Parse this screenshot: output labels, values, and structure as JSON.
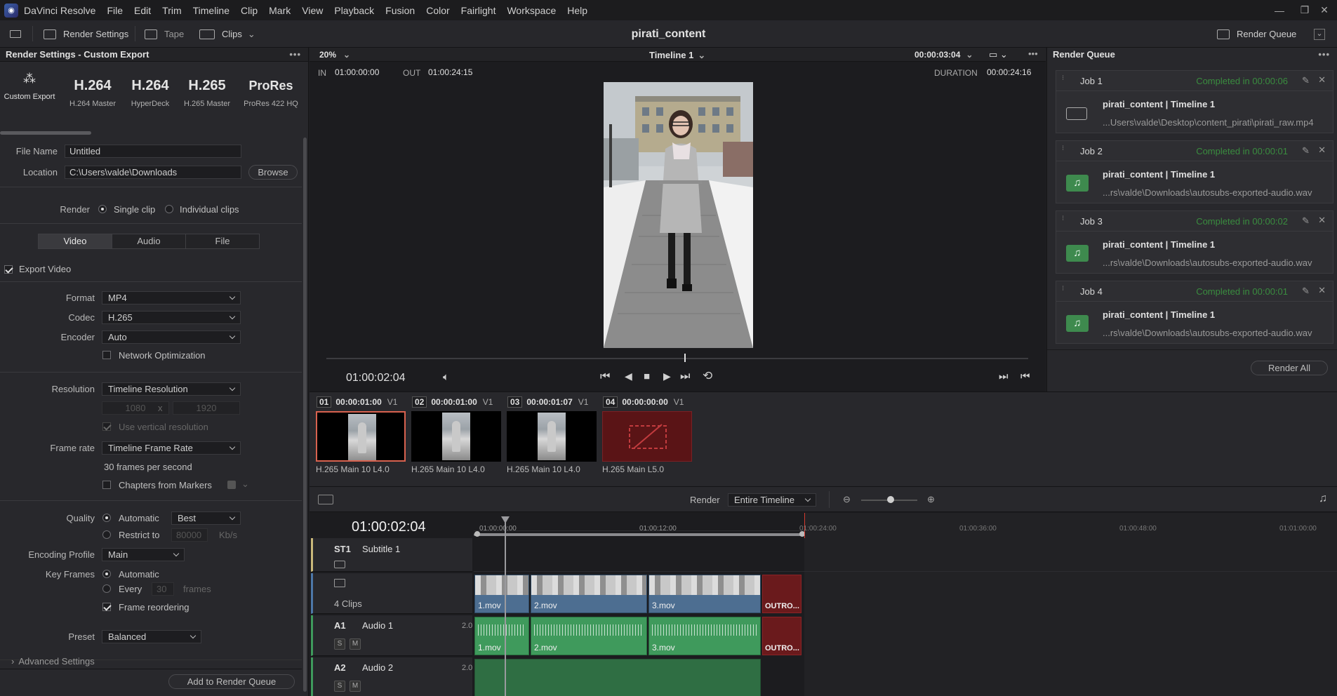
{
  "app": {
    "name": "DaVinci Resolve",
    "menu": [
      "File",
      "Edit",
      "Trim",
      "Timeline",
      "Clip",
      "Mark",
      "View",
      "Playback",
      "Fusion",
      "Color",
      "Fairlight",
      "Workspace",
      "Help"
    ]
  },
  "toolbar": {
    "render_settings": "Render Settings",
    "tape": "Tape",
    "clips": "Clips",
    "project_title": "pirati_content",
    "render_queue": "Render Queue"
  },
  "render_settings": {
    "title": "Render Settings - Custom Export",
    "presets": [
      {
        "big": "",
        "label": "Custom Export"
      },
      {
        "big": "H.264",
        "label": "H.264 Master"
      },
      {
        "big": "H.264",
        "label": "HyperDeck"
      },
      {
        "big": "H.265",
        "label": "H.265 Master"
      },
      {
        "big": "ProRes",
        "label": "ProRes 422 HQ"
      }
    ],
    "file_name_label": "File Name",
    "file_name_value": "Untitled",
    "location_label": "Location",
    "location_value": "C:\\Users\\valde\\Downloads",
    "browse": "Browse",
    "render_label": "Render",
    "single_clip": "Single clip",
    "individual_clips": "Individual clips",
    "tabs": [
      "Video",
      "Audio",
      "File"
    ],
    "export_video": "Export Video",
    "format_label": "Format",
    "format_value": "MP4",
    "codec_label": "Codec",
    "codec_value": "H.265",
    "encoder_label": "Encoder",
    "encoder_value": "Auto",
    "network_optimization": "Network Optimization",
    "resolution_label": "Resolution",
    "resolution_value": "Timeline Resolution",
    "res_w": "1080",
    "res_x": "x",
    "res_h": "1920",
    "use_vertical": "Use vertical resolution",
    "frame_rate_label": "Frame rate",
    "frame_rate_value": "Timeline Frame Rate",
    "fps_text": "30 frames per second",
    "chapters": "Chapters from Markers",
    "quality_label": "Quality",
    "quality_auto": "Automatic",
    "quality_best": "Best",
    "restrict_to": "Restrict to",
    "restrict_value": "80000",
    "kbs": "Kb/s",
    "encoding_profile_label": "Encoding Profile",
    "encoding_profile_value": "Main",
    "key_frames_label": "Key Frames",
    "kf_auto": "Automatic",
    "kf_every": "Every",
    "kf_every_value": "30",
    "kf_frames": "frames",
    "frame_reordering": "Frame reordering",
    "preset_label": "Preset",
    "preset_value": "Balanced",
    "advanced": "Advanced Settings",
    "add_to_queue": "Add to Render Queue"
  },
  "viewer": {
    "zoom": "20%",
    "timeline_name": "Timeline 1",
    "timecode_top": "00:00:03:04",
    "in_label": "IN",
    "in_value": "01:00:00:00",
    "out_label": "OUT",
    "out_value": "01:00:24:15",
    "duration_label": "DURATION",
    "duration_value": "00:00:24:16",
    "current_tc": "01:00:02:04",
    "scrub_progress": 0.51
  },
  "render_queue": {
    "title": "Render Queue",
    "jobs": [
      {
        "title": "Job 1",
        "done": "Completed in 00:00:06",
        "name": "pirati_content | Timeline 1",
        "path": "...Users\\valde\\Desktop\\content_pirati\\pirati_raw.mp4",
        "icon": "film-icon"
      },
      {
        "title": "Job 2",
        "done": "Completed in 00:00:01",
        "name": "pirati_content | Timeline 1",
        "path": "...rs\\valde\\Downloads\\autosubs-exported-audio.wav",
        "icon": "music-icon"
      },
      {
        "title": "Job 3",
        "done": "Completed in 00:00:02",
        "name": "pirati_content | Timeline 1",
        "path": "...rs\\valde\\Downloads\\autosubs-exported-audio.wav",
        "icon": "music-icon"
      },
      {
        "title": "Job 4",
        "done": "Completed in 00:00:01",
        "name": "pirati_content | Timeline 1",
        "path": "...rs\\valde\\Downloads\\autosubs-exported-audio.wav",
        "icon": "music-icon"
      }
    ],
    "render_all": "Render All"
  },
  "clips": [
    {
      "num": "01",
      "tc": "00:00:01:00",
      "track": "V1",
      "codec": "H.265 Main 10 L4.0",
      "offline": false
    },
    {
      "num": "02",
      "tc": "00:00:01:00",
      "track": "V1",
      "codec": "H.265 Main 10 L4.0",
      "offline": false
    },
    {
      "num": "03",
      "tc": "00:00:01:07",
      "track": "V1",
      "codec": "H.265 Main 10 L4.0",
      "offline": false
    },
    {
      "num": "04",
      "tc": "00:00:00:00",
      "track": "V1",
      "codec": "H.265 Main L5.0",
      "offline": true
    }
  ],
  "timeline": {
    "render_label": "Render",
    "render_range": "Entire Timeline",
    "current_tc": "01:00:02:04",
    "ruler": [
      "01:00:00:00",
      "01:00:12:00",
      "01:00:24:00",
      "01:00:36:00",
      "01:00:48:00",
      "01:01:00:00"
    ],
    "tracks": {
      "subtitle": {
        "code": "ST1",
        "name": "Subtitle 1"
      },
      "video": {
        "clips_count": "4 Clips",
        "clips": [
          "1.mov",
          "2.mov",
          "3.mov",
          "OUTRO..."
        ]
      },
      "audio1": {
        "code": "A1",
        "name": "Audio 1",
        "ch": "2.0",
        "clips": [
          "1.mov",
          "2.mov",
          "3.mov",
          "OUTRO..."
        ]
      },
      "audio2": {
        "code": "A2",
        "name": "Audio 2",
        "ch": "2.0"
      },
      "solo": "S",
      "mute": "M"
    }
  }
}
